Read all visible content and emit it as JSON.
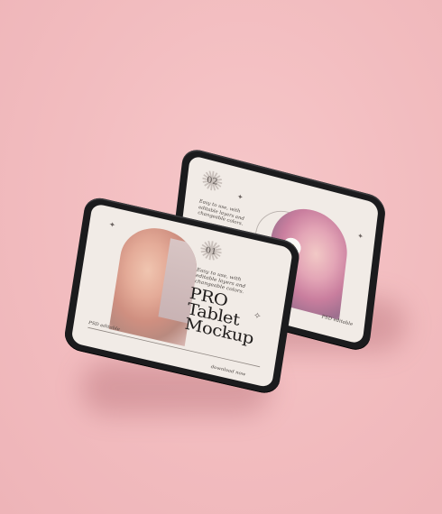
{
  "colors": {
    "background": "#f2bcbf",
    "bezel": "#1b1b1d",
    "screen": "#f1ebe6",
    "text_dark": "#1f1c1b"
  },
  "back_tablet": {
    "number": "02",
    "description": "Easy to use, with editable layers and changeable colors.",
    "footer": "PSD editable"
  },
  "front_tablet": {
    "number": "01",
    "description": "Easy to use, with editable layers and changeable colors.",
    "title_line1": "PRO",
    "title_line2": "Tablet",
    "title_line3": "Mockup",
    "footer_left": "PSD editable",
    "footer_right": "download now"
  },
  "icons": {
    "sparkle": "sparkle-icon",
    "badge": "star-badge-icon"
  }
}
